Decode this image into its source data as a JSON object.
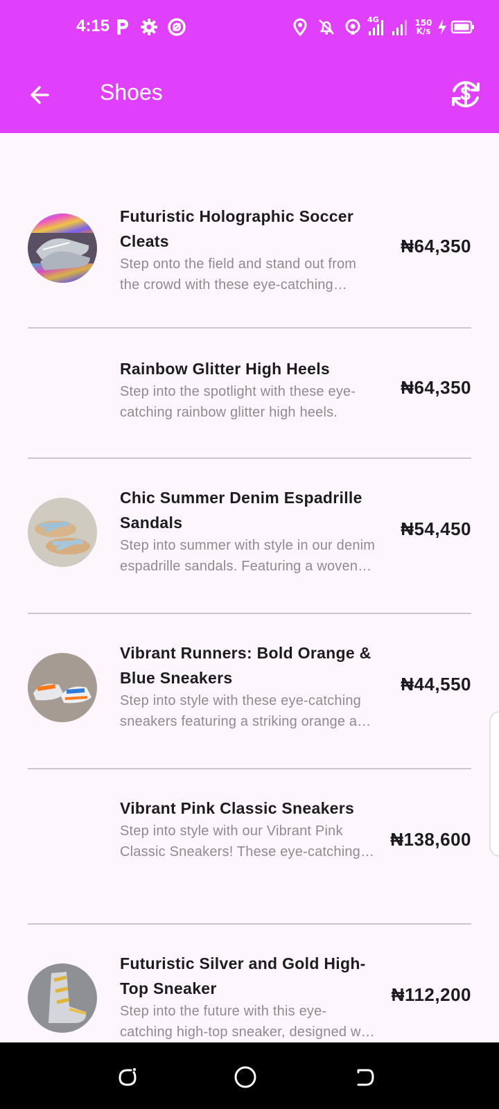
{
  "status_bar": {
    "time": "4:15",
    "net_speed_value": "150",
    "net_speed_unit": "K/s",
    "network_type": "4G",
    "icons": [
      "parking-icon",
      "settings-icon",
      "app-status-icon",
      "location-icon",
      "alarm-off-icon",
      "hotspot-icon",
      "signal-icon",
      "signal-icon-2",
      "charging-icon",
      "battery-icon"
    ]
  },
  "app_bar": {
    "title": "Shoes",
    "back_icon": "back-arrow-icon",
    "action_icon": "currency-exchange-icon",
    "background": "#e040fb"
  },
  "products": [
    {
      "name": "Futuristic Holographic Soccer Cleats",
      "description": "Step onto the field and stand out from the crowd with these eye-catching holographic soccer cleats.",
      "price": "₦64,350",
      "has_image": true
    },
    {
      "name": "Rainbow Glitter High Heels",
      "description": "Step into the spotlight with these eye-catching rainbow glitter high heels.",
      "price": "₦64,350",
      "has_image": false
    },
    {
      "name": "Chic Summer Denim Espadrille Sandals",
      "description": "Step into summer with style in our denim espadrille sandals. Featuring a woven jute sole.",
      "price": "₦54,450",
      "has_image": true
    },
    {
      "name": "Vibrant Runners: Bold Orange & Blue Sneakers",
      "description": "Step into style with these eye-catching sneakers featuring a striking orange and blue design.",
      "price": "₦44,550",
      "has_image": true
    },
    {
      "name": "Vibrant Pink Classic Sneakers",
      "description": "Step into style with our Vibrant Pink Classic Sneakers! These eye-catching shoes.",
      "price": "₦138,600",
      "has_image": false
    },
    {
      "name": "Futuristic Silver and Gold High-Top Sneaker",
      "description": "Step into the future with this eye-catching high-top sneaker, designed with silver and gold accents.",
      "price": "₦112,200",
      "has_image": true
    }
  ],
  "nav_bar": {
    "icons": [
      "recents-icon",
      "home-icon",
      "back-nav-icon"
    ]
  }
}
